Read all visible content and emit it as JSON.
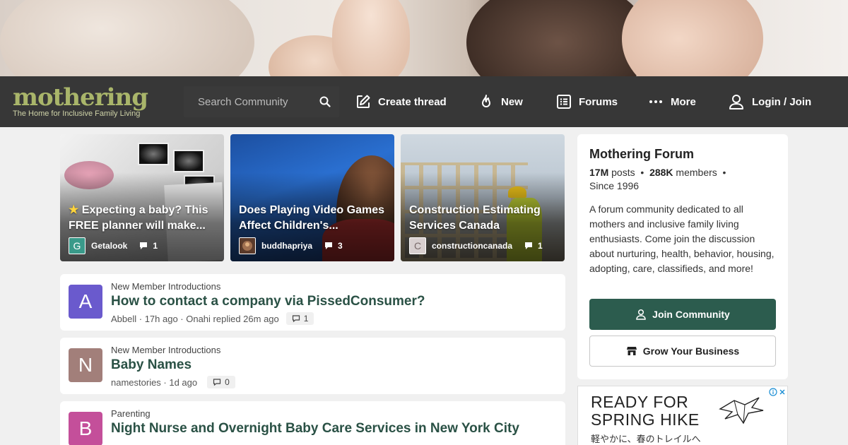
{
  "site": {
    "logo_word": "mothering",
    "logo_tagline": "The Home for Inclusive Family Living"
  },
  "nav": {
    "search_placeholder": "Search Community",
    "create_thread": "Create thread",
    "new": "New",
    "forums": "Forums",
    "more": "More",
    "login": "Login / Join"
  },
  "featured": [
    {
      "title": "Expecting a baby? This FREE planner will make...",
      "author": "Getalook",
      "avatar_letter": "G",
      "comments": "1",
      "starred": true
    },
    {
      "title": "Does Playing Video Games Affect Children's...",
      "author": "buddhapriya",
      "avatar_letter": "",
      "comments": "3"
    },
    {
      "title": "Construction Estimating Services Canada",
      "author": "constructioncanada",
      "avatar_letter": "C",
      "comments": "1"
    }
  ],
  "threads": [
    {
      "avatar_letter": "A",
      "avatar_color": "#6a5acd",
      "category": "New Member Introductions",
      "title": "How to contact a company via PissedConsumer?",
      "meta": "Abbell · 17h ago · Onahi replied 26m ago",
      "replies": "1"
    },
    {
      "avatar_letter": "N",
      "avatar_color": "#a27f7a",
      "category": "New Member Introductions",
      "title": "Baby Names",
      "meta": "namestories · 1d ago",
      "replies": "0"
    },
    {
      "avatar_letter": "B",
      "avatar_color": "#c44f9a",
      "category": "Parenting",
      "title": "Night Nurse and Overnight Baby Care Services in New York City",
      "meta": "",
      "replies": ""
    }
  ],
  "sidebar": {
    "title": "Mothering Forum",
    "posts_count": "17M",
    "posts_label": "posts",
    "members_count": "288K",
    "members_label": "members",
    "since": "Since 1996",
    "description": "A forum community dedicated to all mothers and inclusive family living enthusiasts. Come join the discussion about nurturing, health, behavior, housing, adopting, care, classifieds, and more!",
    "join_label": "Join Community",
    "grow_label": "Grow Your Business"
  },
  "ad": {
    "line1": "READY FOR",
    "line2": "SPRING HIKE",
    "subline": "軽やかに、春のトレイルへ"
  },
  "colors": {
    "accent_green": "#2c5c4e",
    "title_green": "#2a5145",
    "logo_olive": "#a9b56a"
  }
}
